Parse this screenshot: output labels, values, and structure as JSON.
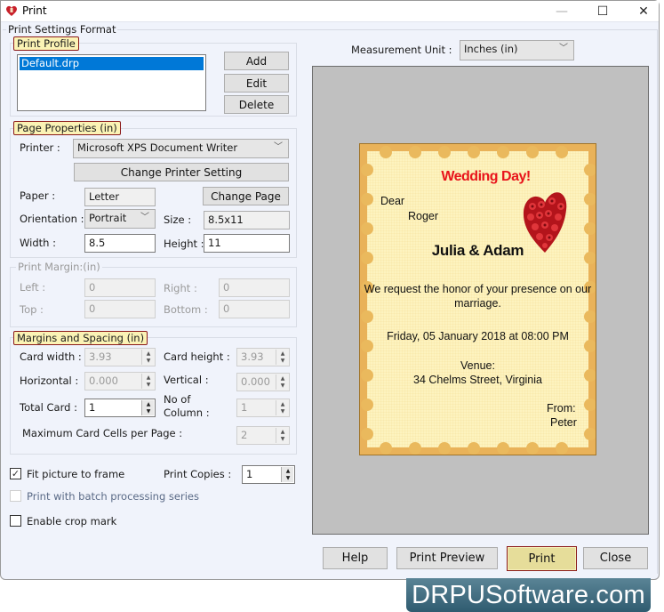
{
  "window": {
    "title": "Print",
    "controls": {
      "minimize": "—",
      "maximize": "☐",
      "close": "✕"
    }
  },
  "settings_format": {
    "label": "Print Settings Format",
    "print_profile": {
      "label": "Print Profile",
      "profiles": [
        "Default.drp"
      ],
      "selected": "Default.drp",
      "buttons": {
        "add": "Add",
        "edit": "Edit",
        "delete": "Delete"
      }
    },
    "page_properties": {
      "label": "Page Properties  (in)",
      "printer_label": "Printer :",
      "printer_value": "Microsoft XPS Document Writer",
      "change_printer_button": "Change Printer Setting",
      "paper_label": "Paper :",
      "paper_value": "Letter",
      "change_page_button": "Change Page",
      "orientation_label": "Orientation :",
      "orientation_value": "Portrait",
      "size_label": "Size :",
      "size_value": "8.5x11",
      "width_label": "Width :",
      "width_value": "8.5",
      "height_label": "Height :",
      "height_value": "11"
    },
    "print_margin": {
      "label": "Print Margin:(in)",
      "left_label": "Left :",
      "left_value": "0",
      "right_label": "Right :",
      "right_value": "0",
      "top_label": "Top :",
      "top_value": "0",
      "bottom_label": "Bottom :",
      "bottom_value": "0"
    },
    "margins_spacing": {
      "label": "Margins and Spacing  (in)",
      "card_width_label": "Card width :",
      "card_width_value": "3.93",
      "card_height_label": "Card height :",
      "card_height_value": "3.93",
      "horizontal_label": "Horizontal :",
      "horizontal_value": "0.000",
      "vertical_label": "Vertical :",
      "vertical_value": "0.000",
      "total_card_label": "Total Card :",
      "total_card_value": "1",
      "no_of_label": "No of",
      "column_label": "Column :",
      "column_value": "1",
      "max_cells_label": "Maximum Card Cells per Page :",
      "max_cells_value": "2"
    },
    "options": {
      "fit_picture_label": "Fit picture to frame",
      "fit_picture_checked": true,
      "print_copies_label": "Print Copies :",
      "print_copies_value": "1",
      "batch_label": "Print with batch processing series",
      "batch_checked": false,
      "crop_mark_label": "Enable crop mark",
      "crop_mark_checked": false
    }
  },
  "measurement": {
    "label": "Measurement Unit :",
    "value": "Inches (in)"
  },
  "card_preview": {
    "title": "Wedding Day!",
    "dear": "Dear",
    "recipient": "Roger",
    "names": "Julia & Adam",
    "message_line1": "We request the honor of your presence on our",
    "message_line2": "marriage.",
    "date": "Friday, 05 January 2018 at 08:00 PM",
    "venue_label": "Venue:",
    "venue": "34 Chelms Street, Virginia",
    "from_label": "From:",
    "sender": "Peter",
    "title_color": "#e8141b",
    "image": "rose-heart"
  },
  "footer_buttons": {
    "help": "Help",
    "print_preview": "Print Preview",
    "print": "Print",
    "close": "Close"
  },
  "watermark": "DRPUSoftware.com"
}
